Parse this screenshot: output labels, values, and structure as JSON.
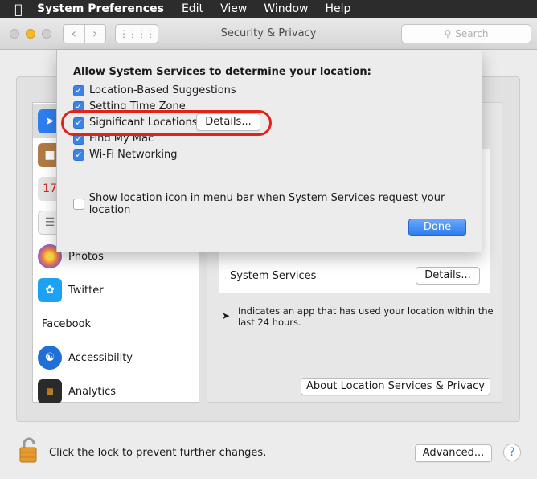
{
  "menubar": {
    "app_name": "System Preferences",
    "items": [
      "Edit",
      "View",
      "Window",
      "Help"
    ]
  },
  "window": {
    "title": "Security & Privacy",
    "search_placeholder": "Search"
  },
  "sidebar": {
    "items": [
      {
        "label": "",
        "icon": "location-arrow-icon",
        "color": "#2f7ff0"
      },
      {
        "label": "",
        "icon": "contacts-icon",
        "color": "#b07b45"
      },
      {
        "label": "",
        "icon": "calendar-icon",
        "color": "#e4e4e4"
      },
      {
        "label": "",
        "icon": "reminders-icon",
        "color": "#f2f2f2"
      },
      {
        "label": "Photos",
        "icon": "photos-icon",
        "color": "#f4a31e"
      },
      {
        "label": "Twitter",
        "icon": "twitter-icon",
        "color": "#1da1f2"
      },
      {
        "label": "Facebook",
        "icon": "",
        "color": ""
      },
      {
        "label": "Accessibility",
        "icon": "accessibility-icon",
        "color": "#1f6fd6"
      },
      {
        "label": "Analytics",
        "icon": "analytics-icon",
        "color": "#2a2a2a"
      }
    ]
  },
  "main": {
    "system_services_label": "System Services",
    "details_button": "Details...",
    "note": "Indicates an app that has used your location within the last 24 hours.",
    "about_button": "About Location Services & Privacy"
  },
  "footer": {
    "lock_text": "Click the lock to prevent further changes.",
    "advanced_button": "Advanced...",
    "help_button": "?"
  },
  "sheet": {
    "title": "Allow System Services to determine your location:",
    "options": [
      {
        "label": "Location-Based Suggestions",
        "checked": true
      },
      {
        "label": "Setting Time Zone",
        "checked": true
      },
      {
        "label": "Significant Locations",
        "checked": true
      },
      {
        "label": "Find My Mac",
        "checked": true
      },
      {
        "label": "Wi-Fi Networking",
        "checked": true
      }
    ],
    "details_button": "Details...",
    "menu_bar_option": {
      "label": "Show location icon in menu bar when System Services request your location",
      "checked": false
    },
    "done_button": "Done"
  },
  "colors": {
    "accent": "#3b83e7",
    "highlight": "#e0241c"
  }
}
